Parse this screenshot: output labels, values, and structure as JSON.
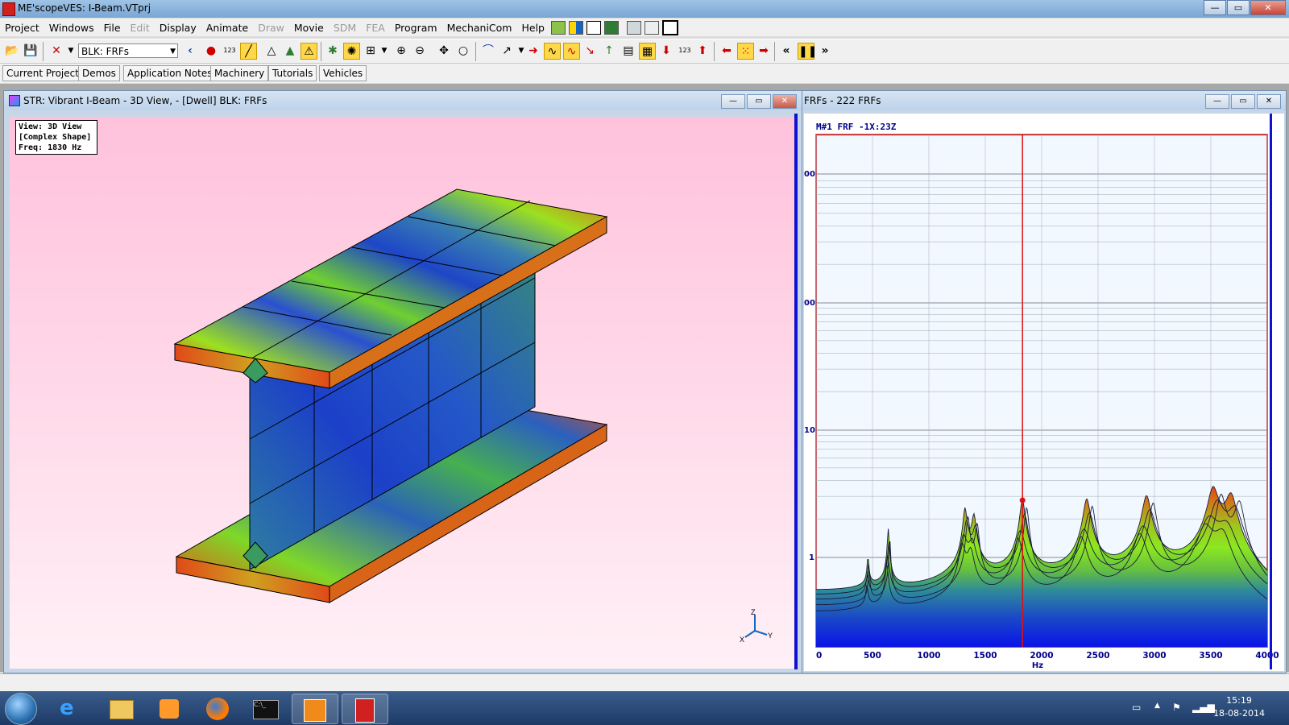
{
  "app": {
    "title": "ME'scopeVES: I-Beam.VTprj"
  },
  "window_buttons": {
    "minimize": "—",
    "restore": "▭",
    "close": "✕"
  },
  "menu": {
    "items": [
      "Project",
      "Windows",
      "File",
      "Edit",
      "Display",
      "Animate",
      "Draw",
      "Movie",
      "SDM",
      "FEA",
      "Program",
      "MechaniCom",
      "Help"
    ],
    "disabled": [
      "Edit",
      "Draw",
      "SDM",
      "FEA"
    ]
  },
  "toolbar": {
    "combo_value": "BLK: FRFs",
    "count_icon": "123"
  },
  "tabs": [
    "Current Project",
    "Demos",
    "Application Notes",
    "Machinery",
    "Tutorials",
    "Vehicles"
  ],
  "left_window": {
    "title": "STR: Vibrant I-Beam - 3D View,  - [Dwell] BLK: FRFs",
    "info_lines": [
      "View: 3D View",
      "[Complex Shape]",
      "Freq: 1830 Hz"
    ],
    "axes": {
      "z": "Z",
      "x": "X",
      "y": "Y"
    }
  },
  "right_window": {
    "title": "FRFs - 222 FRFs",
    "plot_label": "M#1 FRF -1X:23Z",
    "y_tick_labels": [
      "00",
      "00",
      "10",
      "1"
    ],
    "x_ticks": [
      0,
      500,
      1000,
      1500,
      2000,
      2500,
      3000,
      3500,
      4000
    ],
    "x_unit": "Hz",
    "cursor_freq": 1830
  },
  "chart_data": {
    "type": "line",
    "title": "M#1 FRF -1X:23Z",
    "xlabel": "Hz",
    "ylabel": "",
    "xlim": [
      0,
      4000
    ],
    "y_scale": "log",
    "series_count_label": "222 FRFs",
    "peaks_hz": [
      460,
      640,
      1320,
      1400,
      1830,
      2400,
      2930,
      3520,
      3680
    ],
    "cursor_hz": 1830,
    "grid": true
  },
  "colors": {
    "cursor": "#e01010",
    "plot_border": "#c00000",
    "axis_text": "#00008b"
  },
  "taskbar": {
    "time": "15:19",
    "date": "18-08-2014"
  }
}
